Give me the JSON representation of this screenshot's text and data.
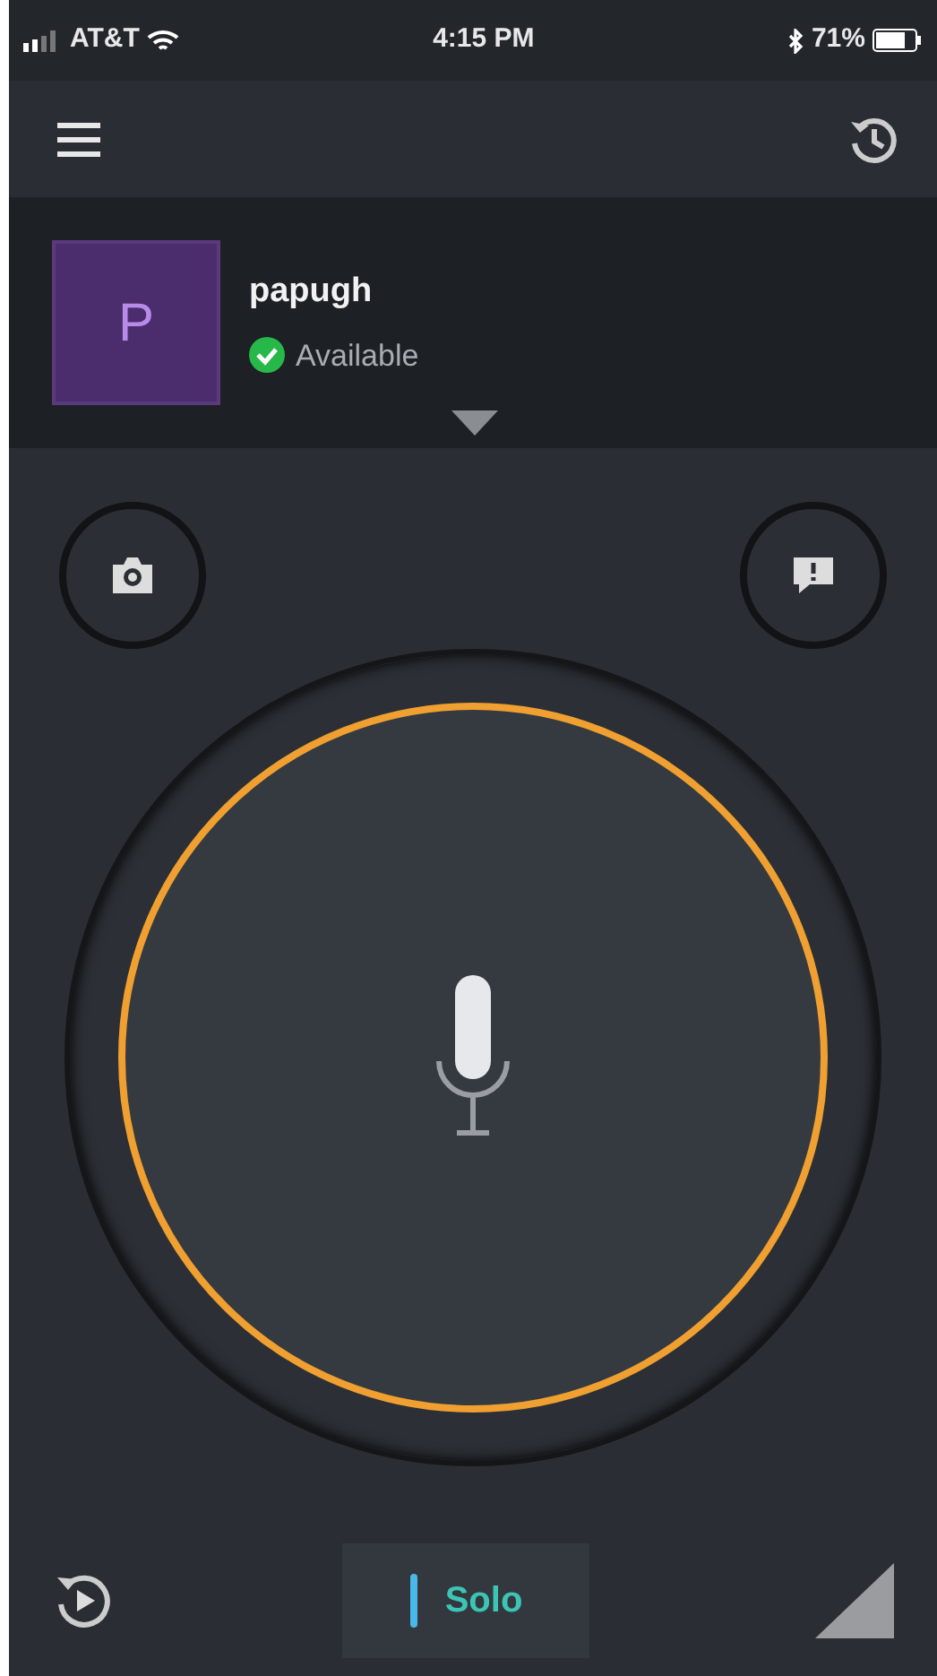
{
  "status_bar": {
    "carrier": "AT&T",
    "time": "4:15 PM",
    "battery": "71%"
  },
  "profile": {
    "initial": "P",
    "username": "papugh",
    "presence": "Available"
  },
  "talk_button": {
    "active": true
  },
  "mode_button": {
    "label": "Solo"
  }
}
